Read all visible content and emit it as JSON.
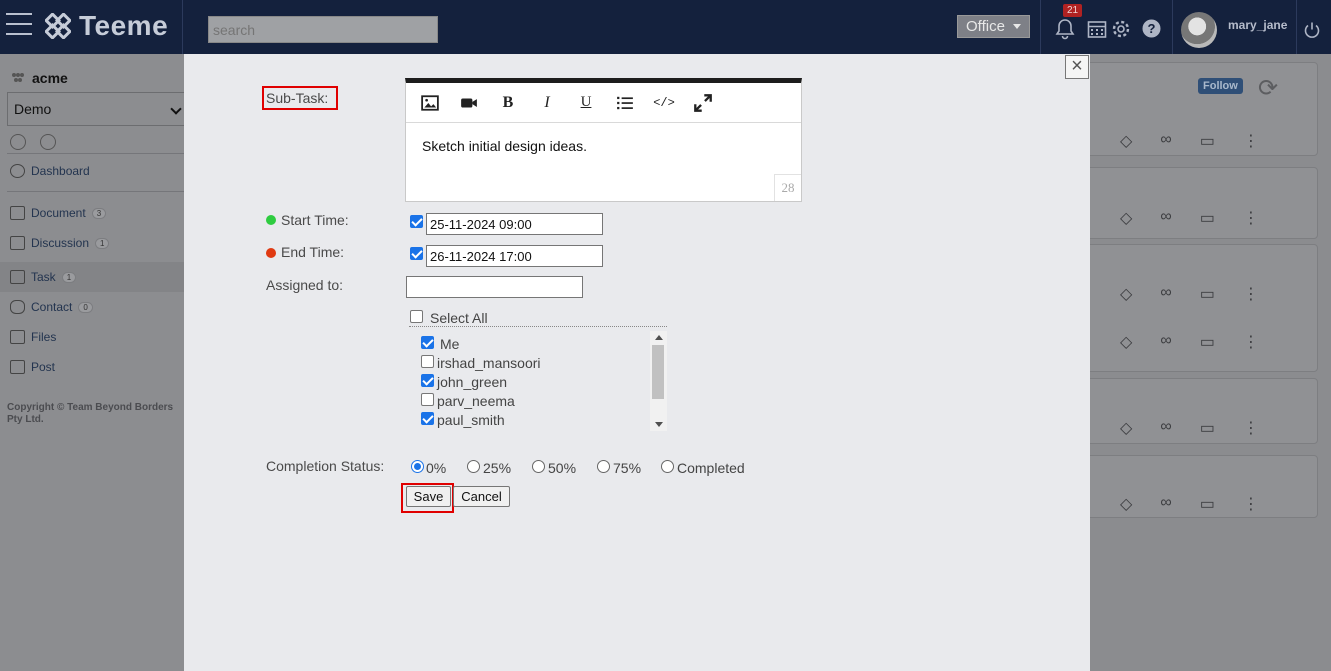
{
  "topbar": {
    "app_name": "Teeme",
    "search_placeholder": "search",
    "workspace": "Office",
    "notification_count": "21",
    "username": "mary_jane"
  },
  "sidebar": {
    "org_name": "acme",
    "space_selected": "Demo",
    "items": [
      {
        "label": "Dashboard",
        "count": ""
      },
      {
        "label": "Document",
        "count": "3"
      },
      {
        "label": "Discussion",
        "count": "1"
      },
      {
        "label": "Task",
        "count": "1"
      },
      {
        "label": "Contact",
        "count": "0"
      },
      {
        "label": "Files",
        "count": ""
      },
      {
        "label": "Post",
        "count": ""
      }
    ],
    "copyright": "Copyright © Team Beyond Borders Pty Ltd."
  },
  "right_panel": {
    "follow_label": "Follow"
  },
  "modal": {
    "subtask_label": "Sub-Task:",
    "editor_text": "Sketch initial design ideas.",
    "char_count": "28",
    "start_label": "Start Time:",
    "start_value": "25-11-2024 09:00",
    "end_label": "End Time:",
    "end_value": "26-11-2024 17:00",
    "assigned_label": "Assigned to:",
    "assigned_value": "",
    "select_all_label": "Select All",
    "users": [
      {
        "name": "Me",
        "checked": true
      },
      {
        "name": "irshad_mansoori",
        "checked": false
      },
      {
        "name": "john_green",
        "checked": true
      },
      {
        "name": "parv_neema",
        "checked": false
      },
      {
        "name": "paul_smith",
        "checked": true
      }
    ],
    "completion_label": "Completion Status:",
    "completion_options": [
      "0%",
      "25%",
      "50%",
      "75%",
      "Completed"
    ],
    "completion_selected": "0%",
    "save_label": "Save",
    "cancel_label": "Cancel",
    "close_glyph": "×"
  },
  "colors": {
    "topbar": "#14213d",
    "highlight": "#e00000",
    "start_dot": "#2ecc40",
    "end_dot": "#e03a12",
    "checkbox": "#1a73e8"
  },
  "icons": {
    "editor_toolbar": [
      "image-icon",
      "video-icon",
      "bold-icon",
      "italic-icon",
      "underline-icon",
      "list-icon",
      "code-icon",
      "expand-icon"
    ]
  }
}
